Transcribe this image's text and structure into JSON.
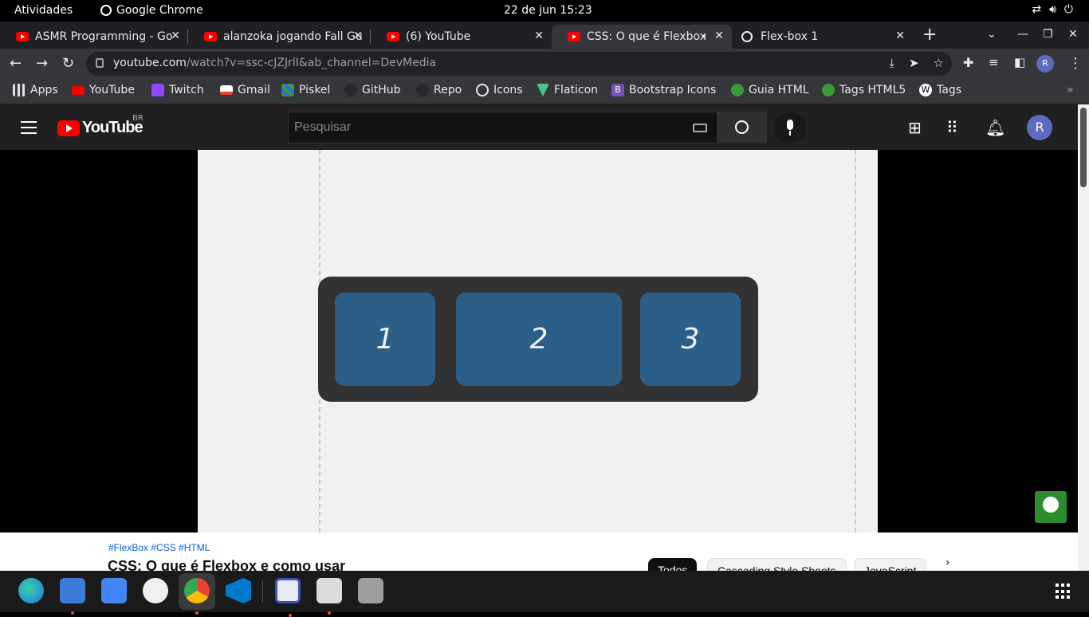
{
  "system_bar": {
    "activities": "Atividades",
    "app_name": "Google Chrome",
    "clock": "22 de jun  15:23"
  },
  "tabs": [
    {
      "title": "ASMR Programming - Go",
      "icon": "youtube-icon",
      "active": false
    },
    {
      "title": "alanzoka jogando Fall Gu",
      "icon": "youtube-icon",
      "active": false
    },
    {
      "title": "(6) YouTube",
      "icon": "youtube-icon",
      "active": false
    },
    {
      "title": "CSS: O que é Flexbox",
      "icon": "youtube-icon",
      "active": true
    },
    {
      "title": "Flex-box 1",
      "icon": "globe-icon",
      "active": false
    }
  ],
  "address_bar": {
    "url_host": "youtube.com",
    "url_path": "/watch?v=ssc-cJZJrlI&ab_channel=DevMedia",
    "profile_initial": "R"
  },
  "bookmarks": [
    {
      "label": "Apps",
      "icon": "apps-grid-icon",
      "color": "#e0e0e0"
    },
    {
      "label": "YouTube",
      "icon": "youtube-icon",
      "color": "#ff0000"
    },
    {
      "label": "Twitch",
      "icon": "twitch-icon",
      "color": "#9146ff"
    },
    {
      "label": "Gmail",
      "icon": "gmail-icon",
      "color": "#ea4335"
    },
    {
      "label": "Piskel",
      "icon": "piskel-icon",
      "color": "#3b9c3b"
    },
    {
      "label": "GitHub",
      "icon": "github-icon",
      "color": "#24292e"
    },
    {
      "label": "Repo",
      "icon": "github-icon",
      "color": "#24292e"
    },
    {
      "label": "Icons",
      "icon": "globe-icon",
      "color": "#e8eaed"
    },
    {
      "label": "Flaticon",
      "icon": "flaticon-icon",
      "color": "#4fc08d"
    },
    {
      "label": "Bootstrap Icons",
      "icon": "bootstrap-icon",
      "color": "#7952b3"
    },
    {
      "label": "Guia HTML",
      "icon": "html-guide-icon",
      "color": "#3a9a3a"
    },
    {
      "label": "Tags HTML5",
      "icon": "html-guide-icon",
      "color": "#3a9a3a"
    },
    {
      "label": "Tags",
      "icon": "w-icon",
      "color": "#ffffff"
    }
  ],
  "youtube": {
    "logo_text": "YouTube",
    "country_code": "BR",
    "search_placeholder": "Pesquisar",
    "profile_initial": "R",
    "video": {
      "flex_items": [
        "1",
        "2",
        "3"
      ]
    },
    "hashtags": "#FlexBox #CSS #HTML",
    "title": "CSS: O que é Flexbox e como usar",
    "chips": [
      "Todos",
      "Cascading Style Sheets",
      "JavaScript"
    ]
  },
  "colors": {
    "chrome_dark": "#35363a",
    "tabstrip": "#1f2023",
    "youtube_red": "#ff0000",
    "flex_item_blue": "#2b5f87",
    "flex_container": "#323232",
    "dock_running": "#e95420"
  }
}
